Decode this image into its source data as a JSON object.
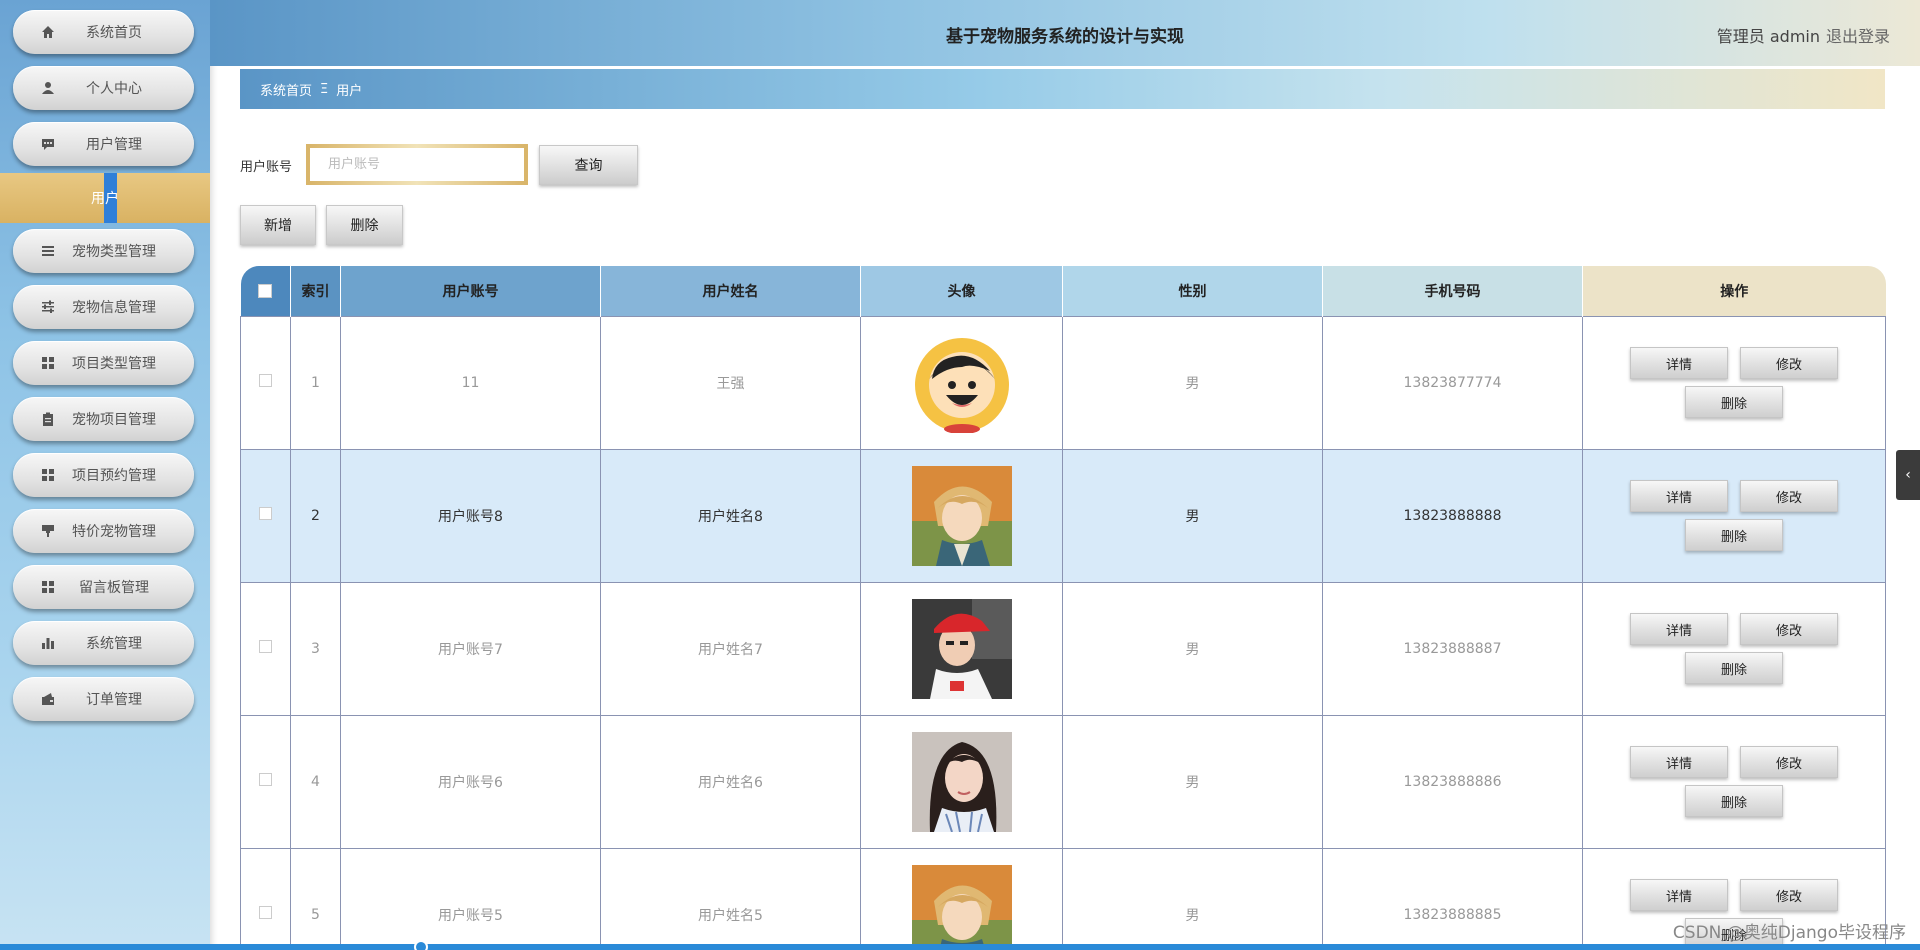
{
  "app": {
    "title": "基于宠物服务系统的设计与实现",
    "user_label": "管理员 admin",
    "logout": "退出登录"
  },
  "sidebar": {
    "items": [
      {
        "label": "系统首页",
        "icon": "home-icon"
      },
      {
        "label": "个人中心",
        "icon": "user-icon"
      },
      {
        "label": "用户管理",
        "icon": "chat-icon"
      },
      {
        "label": "宠物类型管理",
        "icon": "list-icon"
      },
      {
        "label": "宠物信息管理",
        "icon": "sliders-icon"
      },
      {
        "label": "项目类型管理",
        "icon": "grid-icon"
      },
      {
        "label": "宠物项目管理",
        "icon": "clipboard-icon"
      },
      {
        "label": "项目预约管理",
        "icon": "grid-icon"
      },
      {
        "label": "特价宠物管理",
        "icon": "brush-icon"
      },
      {
        "label": "留言板管理",
        "icon": "grid-icon"
      },
      {
        "label": "系统管理",
        "icon": "bar-chart-icon"
      },
      {
        "label": "订单管理",
        "icon": "wallet-icon"
      }
    ],
    "sub_item": "用户"
  },
  "breadcrumb": {
    "home": "系统首页",
    "sep": "Ξ",
    "current": "用户"
  },
  "search": {
    "label": "用户账号",
    "placeholder": "用户账号",
    "value": "",
    "button": "查询"
  },
  "actions": {
    "add": "新增",
    "delete": "删除"
  },
  "table": {
    "headers": {
      "index": "索引",
      "account": "用户账号",
      "name": "用户姓名",
      "avatar": "头像",
      "gender": "性别",
      "phone": "手机号码",
      "ops": "操作"
    },
    "op_labels": {
      "detail": "详情",
      "edit": "修改",
      "delete": "删除"
    },
    "rows": [
      {
        "index": "1",
        "account": "11",
        "name": "王强",
        "avatar": "cartoon-boy-avatar",
        "gender": "男",
        "phone": "13823877774"
      },
      {
        "index": "2",
        "account": "用户账号8",
        "name": "用户姓名8",
        "avatar": "anime-boy-avatar",
        "gender": "男",
        "phone": "13823888888"
      },
      {
        "index": "3",
        "account": "用户账号7",
        "name": "用户姓名7",
        "avatar": "red-cap-boy-avatar",
        "gender": "男",
        "phone": "13823888887"
      },
      {
        "index": "4",
        "account": "用户账号6",
        "name": "用户姓名6",
        "avatar": "girl-photo-avatar",
        "gender": "男",
        "phone": "13823888886"
      },
      {
        "index": "5",
        "account": "用户账号5",
        "name": "用户姓名5",
        "avatar": "anime-boy-avatar",
        "gender": "男",
        "phone": "13823888885"
      }
    ]
  },
  "watermark": "CSDN @奥纯Django毕设程序",
  "colors": {
    "accent_blue": "#2f7fd8",
    "gold": "#d9b262",
    "highlight_row": "#d8eaf9"
  }
}
